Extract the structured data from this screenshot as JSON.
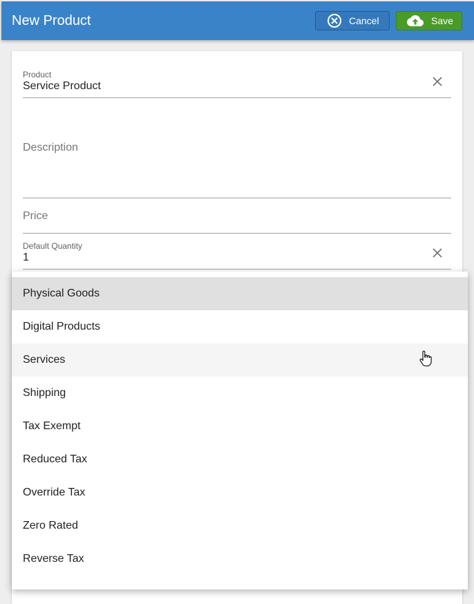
{
  "header": {
    "title": "New Product",
    "cancel_label": "Cancel",
    "save_label": "Save",
    "bar_color": "#3a83c9",
    "save_color": "#4a9a2a"
  },
  "form": {
    "product": {
      "label": "Product",
      "value": "Service Product"
    },
    "description": {
      "placeholder": "Description"
    },
    "price": {
      "placeholder": "Price"
    },
    "default_quantity": {
      "label": "Default Quantity",
      "value": "1"
    }
  },
  "dropdown": {
    "selected": "Physical Goods",
    "hovered": "Services",
    "options": [
      "Physical Goods",
      "Digital Products",
      "Services",
      "Shipping",
      "Tax Exempt",
      "Reduced Tax",
      "Override Tax",
      "Zero Rated",
      "Reverse Tax"
    ]
  }
}
